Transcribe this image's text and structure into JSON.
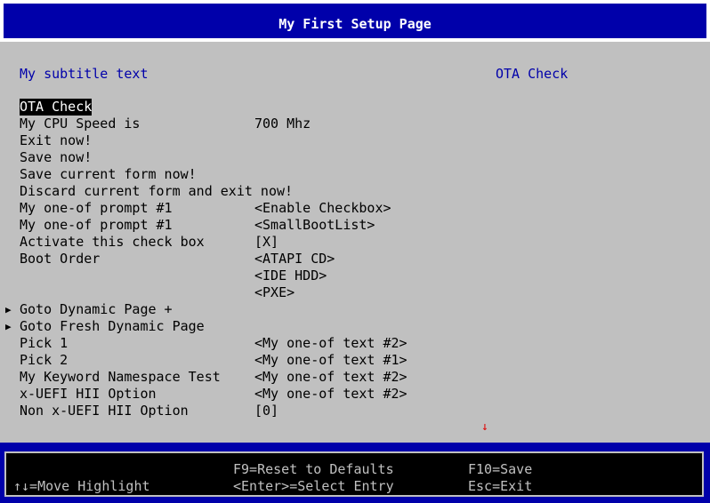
{
  "header": {
    "title": "My First Setup Page"
  },
  "main": {
    "subtitle": "My subtitle text",
    "help_text": "OTA Check",
    "rows": [
      {
        "label": "OTA Check",
        "value": "",
        "selected": true
      },
      {
        "label": "My CPU Speed is",
        "value": "700 Mhz"
      },
      {
        "label": "Exit now!",
        "value": ""
      },
      {
        "label": "Save now!",
        "value": ""
      },
      {
        "label": "Save current form now!",
        "value": ""
      },
      {
        "label": "Discard current form and exit now!",
        "value": ""
      },
      {
        "label": "My one-of prompt #1",
        "value": "<Enable Checkbox>"
      },
      {
        "label": "My one-of prompt #1",
        "value": "<SmallBootList>"
      },
      {
        "label": "Activate this check box",
        "value": "[X]"
      },
      {
        "label": "Boot Order",
        "value": "<ATAPI CD>"
      },
      {
        "label": "",
        "value": "<IDE HDD>"
      },
      {
        "label": "",
        "value": "<PXE>"
      },
      {
        "label": "Goto Dynamic Page +",
        "value": "",
        "submenu": true
      },
      {
        "label": "Goto Fresh Dynamic Page",
        "value": "",
        "submenu": true
      },
      {
        "label": "Pick 1",
        "value": "<My one-of text #2>"
      },
      {
        "label": "Pick 2",
        "value": "<My one-of text #1>"
      },
      {
        "label": "My Keyword Namespace Test",
        "value": "<My one-of text #2>"
      },
      {
        "label": "x-UEFI HII Option",
        "value": "<My one-of text #2>"
      },
      {
        "label": "Non x-UEFI HII Option",
        "value": "[0]"
      }
    ],
    "submenu_arrow": "▶",
    "scroll_indicator": "↓"
  },
  "footer": {
    "move_highlight": "↑↓=Move Highlight",
    "reset_defaults": "F9=Reset to Defaults",
    "select_entry": "<Enter>=Select Entry",
    "save": "F10=Save",
    "exit": "Esc=Exit"
  },
  "colors": {
    "header_bg": "#0000aa",
    "body_bg": "#c0c0c0",
    "subtitle": "#0000aa",
    "highlight_bg": "#000000",
    "scroll_indicator": "#e00000"
  }
}
